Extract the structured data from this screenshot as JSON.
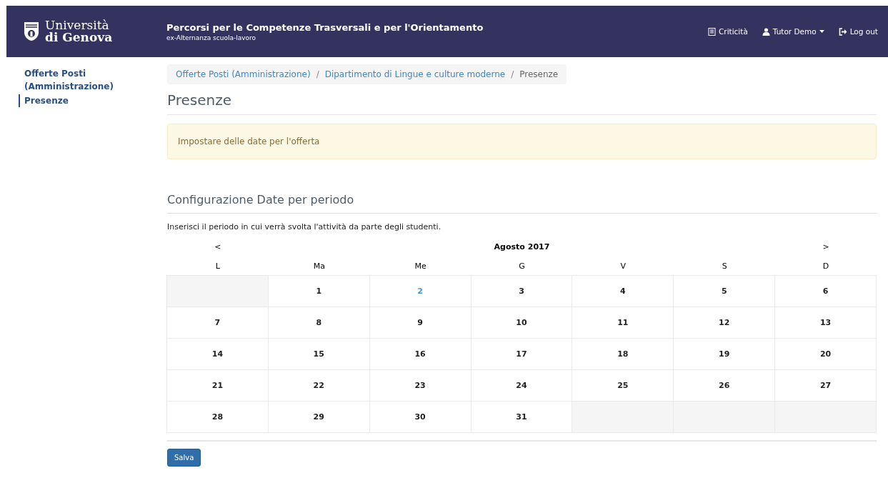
{
  "navbar": {
    "logo_line1": "Università",
    "logo_line2": "di Genova",
    "title": "Percorsi per le Competenze Trasversali e per l'Orientamento",
    "subtitle": "ex-Alternanza scuola-lavoro",
    "links": [
      {
        "kind": "list",
        "label": "Criticità"
      },
      {
        "kind": "user",
        "label": "Tutor Demo"
      },
      {
        "kind": "logout",
        "label": "Log out"
      }
    ]
  },
  "sidebar": {
    "items": [
      {
        "label": "Offerte Posti (Amministrazione)",
        "selected": false
      },
      {
        "label": "Presenze",
        "selected": true
      }
    ]
  },
  "breadcrumb": [
    {
      "label": "Offerte Posti (Amministrazione)",
      "link": true
    },
    {
      "separator": "/",
      "label": "Dipartimento di Lingue e culture moderne",
      "link": true
    },
    {
      "separator": "/",
      "label": "Presenze",
      "link": false
    }
  ],
  "page_title": "Presenze",
  "alert": "Impostare delle date per l'offerta",
  "section_title": "Configurazione Date per periodo",
  "instructions": "Inserisci il periodo in cui verrà svolta l'attività da parte degli studenti.",
  "calendar": {
    "prev": "<",
    "month": "Agosto 2017",
    "next": ">",
    "weekdays": [
      "L",
      "Ma",
      "Me",
      "G",
      "V",
      "S",
      "D"
    ],
    "weeks": [
      [
        {
          "kind": "blank"
        },
        {
          "kind": "day",
          "day": "1",
          "today": false
        },
        {
          "kind": "day",
          "day": "2",
          "today": true
        },
        {
          "kind": "day",
          "day": "3",
          "today": false
        },
        {
          "kind": "day",
          "day": "4",
          "today": false
        },
        {
          "kind": "day",
          "day": "5",
          "today": false
        },
        {
          "kind": "day",
          "day": "6",
          "today": false
        }
      ],
      [
        {
          "kind": "day",
          "day": "7",
          "today": false
        },
        {
          "kind": "day",
          "day": "8",
          "today": false
        },
        {
          "kind": "day",
          "day": "9",
          "today": false
        },
        {
          "kind": "day",
          "day": "10",
          "today": false
        },
        {
          "kind": "day",
          "day": "11",
          "today": false
        },
        {
          "kind": "day",
          "day": "12",
          "today": false
        },
        {
          "kind": "day",
          "day": "13",
          "today": false
        }
      ],
      [
        {
          "kind": "day",
          "day": "14",
          "today": false
        },
        {
          "kind": "day",
          "day": "15",
          "today": false
        },
        {
          "kind": "day",
          "day": "16",
          "today": false
        },
        {
          "kind": "day",
          "day": "17",
          "today": false
        },
        {
          "kind": "day",
          "day": "18",
          "today": false
        },
        {
          "kind": "day",
          "day": "19",
          "today": false
        },
        {
          "kind": "day",
          "day": "20",
          "today": false
        }
      ],
      [
        {
          "kind": "day",
          "day": "21",
          "today": false
        },
        {
          "kind": "day",
          "day": "22",
          "today": false
        },
        {
          "kind": "day",
          "day": "23",
          "today": false
        },
        {
          "kind": "day",
          "day": "24",
          "today": false
        },
        {
          "kind": "day",
          "day": "25",
          "today": false
        },
        {
          "kind": "day",
          "day": "26",
          "today": false
        },
        {
          "kind": "day",
          "day": "27",
          "today": false
        }
      ],
      [
        {
          "kind": "day",
          "day": "28",
          "today": false
        },
        {
          "kind": "day",
          "day": "29",
          "today": false
        },
        {
          "kind": "day",
          "day": "30",
          "today": false
        },
        {
          "kind": "day",
          "day": "31",
          "today": false
        },
        {
          "kind": "blank"
        },
        {
          "kind": "blank"
        },
        {
          "kind": "blank"
        }
      ]
    ]
  },
  "save_button": "Salva"
}
